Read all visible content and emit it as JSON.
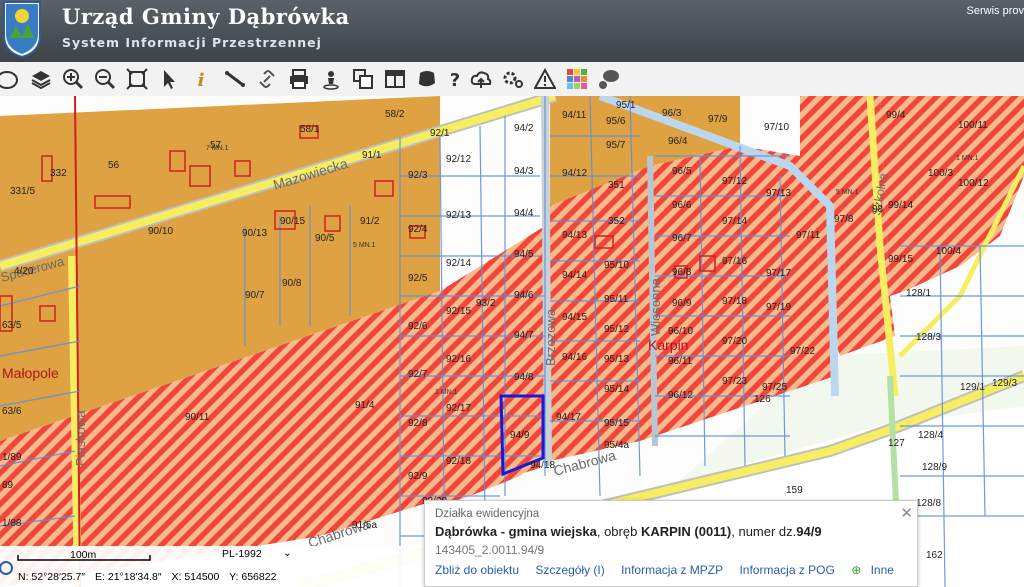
{
  "header": {
    "title": "Urząd Gminy Dąbrówka",
    "subtitle": "System Informacji Przestrzennej",
    "service_link": "Serwis prov"
  },
  "toolbar": {
    "tools": [
      "pan-hand",
      "layers",
      "zoom-in",
      "zoom-out",
      "zoom-extent",
      "select-arrow",
      "info",
      "measure-line",
      "link",
      "print",
      "user-marker",
      "copy",
      "window-layout",
      "shape",
      "help",
      "cloud-upload",
      "settings",
      "warning-triangle",
      "color-grid",
      "chat"
    ]
  },
  "map": {
    "streets": [
      "Mazowiecka",
      "Brzozowa",
      "Wiosenna",
      "Chabrowa",
      "Piaskowa",
      "Chabrowa",
      "Szkolna",
      "Spacerowa"
    ],
    "places": [
      "Karpin",
      "Małopole"
    ],
    "parcels_left": [
      "331/5",
      "332",
      "56",
      "57",
      "58/1",
      "58/2",
      "92/1",
      "91/1",
      "90/15",
      "90/13",
      "90/5",
      "91/2",
      "90/10",
      "90/7",
      "90/8",
      "92/3",
      "92/4",
      "92/5",
      "92/6",
      "92/7",
      "92/8",
      "92/9",
      "92/12",
      "92/13",
      "92/14",
      "92/15",
      "92/16",
      "92/17",
      "92/18",
      "93/2",
      "91/4",
      "90/11",
      "4/20",
      "63/5",
      "63/6",
      "1/89",
      "89",
      "1/88",
      "91/5a",
      "92/20"
    ],
    "parcels_mid": [
      "94/2",
      "94/3",
      "94/4",
      "94/5",
      "94/6",
      "94/7",
      "94/8",
      "94/9",
      "94/11",
      "94/12",
      "94/13",
      "94/14",
      "94/15",
      "94/16",
      "94/17",
      "94/18",
      "351",
      "352",
      "95/1",
      "95/6",
      "95/7",
      "95/10",
      "95/11",
      "95/12",
      "95/13",
      "95/14",
      "95/15",
      "95/4a",
      "96/3",
      "96/4",
      "96/5",
      "96/6",
      "96/7",
      "96/8",
      "96/9",
      "96/10",
      "96/11",
      "96/12",
      "97/9"
    ],
    "parcels_right": [
      "97/10",
      "97/12",
      "97/13",
      "97/14",
      "97/16",
      "97/17",
      "97/18",
      "97/19",
      "97/20",
      "97/22",
      "97/23",
      "97/25",
      "97/8",
      "97/11",
      "98",
      "99/4",
      "99/14",
      "99/15",
      "100/3",
      "100/4",
      "100/11",
      "100/12",
      "126",
      "127",
      "128/1",
      "128/3",
      "128/4",
      "128/9",
      "129/1",
      "129/3",
      "128/8",
      "159",
      "162"
    ],
    "zone_labels": [
      "1 MN.1",
      "7 MN.1",
      "5 MN.1",
      "5 MN.1",
      "1 MN.1"
    ]
  },
  "popup": {
    "category": "Działka ewidencyjna",
    "name_bold": "Dąbrówka - gmina wiejska",
    "obreb_text": ", obręb ",
    "obreb_bold": "KARPIN (0011)",
    "number_text": ", numer dz.",
    "number_bold": "94/9",
    "id": "143405_2.0011.94/9",
    "links": [
      "Zbliż do obiektu",
      "Szczegóły (I)",
      "Informacja z MPZP",
      "Informacja z POG",
      "Inne"
    ]
  },
  "statusbar": {
    "scale": "100m",
    "projection": "PL-1992",
    "coords": [
      "N: 52°28′25.7″",
      "E: 21°18′34.8″",
      "X: 514500",
      "Y: 656822"
    ]
  },
  "colors": {
    "header_bg": "#4c5258",
    "residential": "#dea243",
    "hatch_red": "#f0473a",
    "parcel_line": "#5b8fe0",
    "road": "#f6ee60",
    "selection": "#1c18d6"
  }
}
